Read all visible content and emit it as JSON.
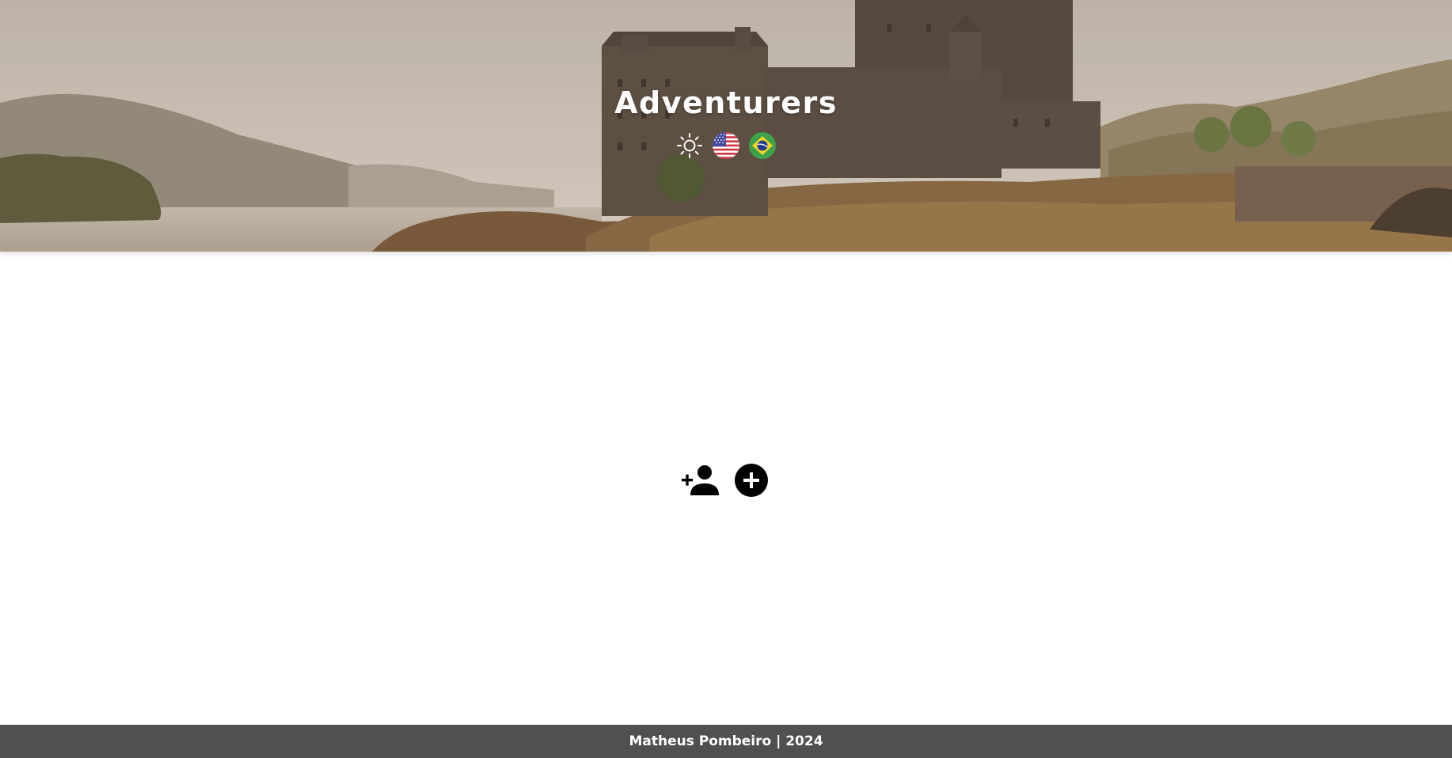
{
  "header": {
    "title": "Adventurers",
    "controls": [
      {
        "name": "theme-toggle",
        "icon": "sun-icon"
      },
      {
        "name": "language-en",
        "icon": "us-flag-icon"
      },
      {
        "name": "language-pt",
        "icon": "brazil-flag-icon"
      }
    ]
  },
  "main": {
    "actions": [
      {
        "name": "add-adventurer-button",
        "icon": "person-add-icon"
      },
      {
        "name": "add-button",
        "icon": "plus-circle-icon"
      }
    ]
  },
  "footer": {
    "text": "Matheus Pombeiro | 2024"
  },
  "colors": {
    "footer_bg": "#505050",
    "page_bg": "#ffffff",
    "title_color": "#ffffff"
  }
}
